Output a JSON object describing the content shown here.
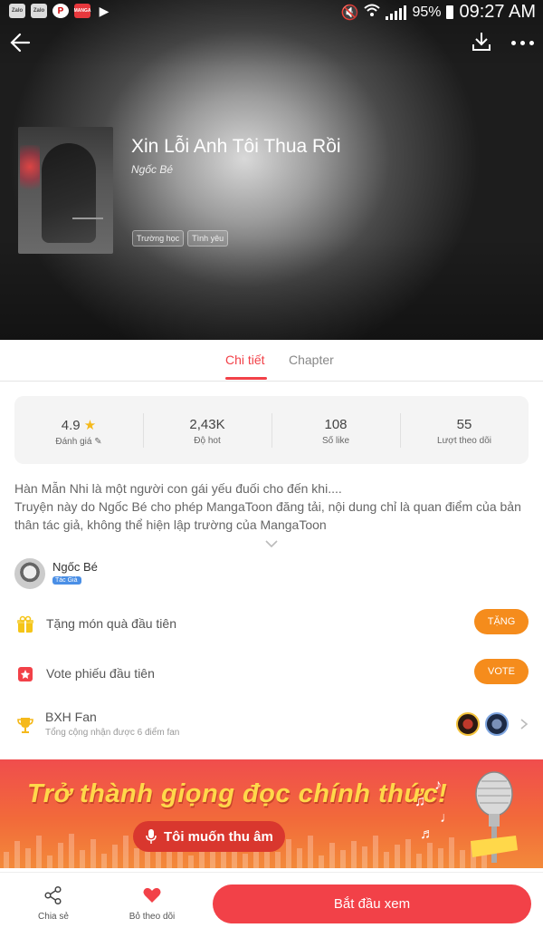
{
  "status_bar": {
    "apps": [
      "Zalo",
      "Zalo",
      "Pinterest",
      "MangaToon",
      "Play Store"
    ],
    "battery": "95%",
    "time": "09:27 AM"
  },
  "book": {
    "title": "Xin Lỗi Anh Tôi Thua Rồi",
    "author": "Ngốc Bé",
    "tags": [
      "Trường học",
      "Tình yêu"
    ]
  },
  "tabs": [
    {
      "label": "Chi tiết",
      "active": true
    },
    {
      "label": "Chapter",
      "active": false
    }
  ],
  "stats": [
    {
      "value": "4.9",
      "label": "Đánh giá"
    },
    {
      "value": "2,43K",
      "label": "Độ hot"
    },
    {
      "value": "108",
      "label": "Số like"
    },
    {
      "value": "55",
      "label": "Lượt theo dõi"
    }
  ],
  "description": {
    "line1": "Hàn Mẫn Nhi là một người con gái yếu đuối cho đến khi....",
    "line2": "Truyện này do Ngốc Bé cho phép MangaToon đăng tải, nội dung chỉ là quan điểm của bản thân tác giả, không thể hiện lập trường của MangaToon"
  },
  "author_card": {
    "name": "Ngốc Bé",
    "badge": "Tác Giả"
  },
  "gift": {
    "label": "Tặng món quà đầu tiên",
    "button": "TẶNG"
  },
  "vote": {
    "label": "Vote phiếu đầu tiên",
    "button": "VOTE"
  },
  "fan": {
    "label": "BXH Fan",
    "sub": "Tổng cộng nhận được 6 điểm fan"
  },
  "banner": {
    "title": "Trở thành giọng đọc chính thức!",
    "button": "Tôi muốn thu âm"
  },
  "bottom": {
    "share": "Chia sẻ",
    "unfollow": "Bỏ theo dõi",
    "start": "Bắt đầu xem"
  },
  "colors": {
    "accent": "#f24148",
    "orange": "#f58c1c",
    "star": "#f5b91b"
  }
}
